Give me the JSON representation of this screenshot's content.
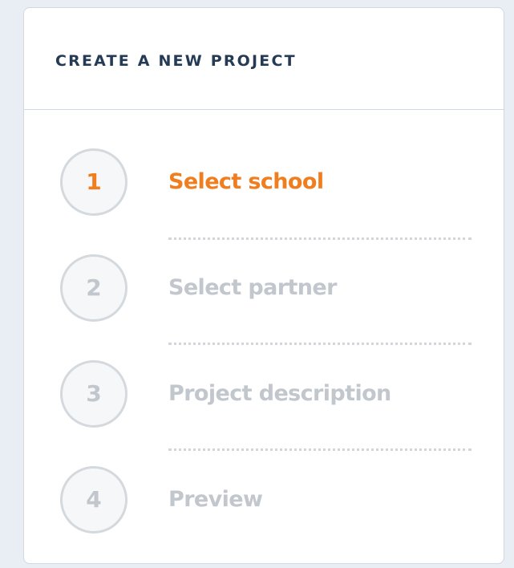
{
  "panel": {
    "title": "CREATE A NEW PROJECT"
  },
  "steps": [
    {
      "number": "1",
      "label": "Select school",
      "state": "active"
    },
    {
      "number": "2",
      "label": "Select partner",
      "state": "inactive"
    },
    {
      "number": "3",
      "label": "Project description",
      "state": "inactive"
    },
    {
      "number": "4",
      "label": "Preview",
      "state": "inactive"
    }
  ],
  "colors": {
    "active": "#f07d1e",
    "inactive": "#c2c7cd",
    "title": "#253a55",
    "divider": "#d2d6db"
  }
}
